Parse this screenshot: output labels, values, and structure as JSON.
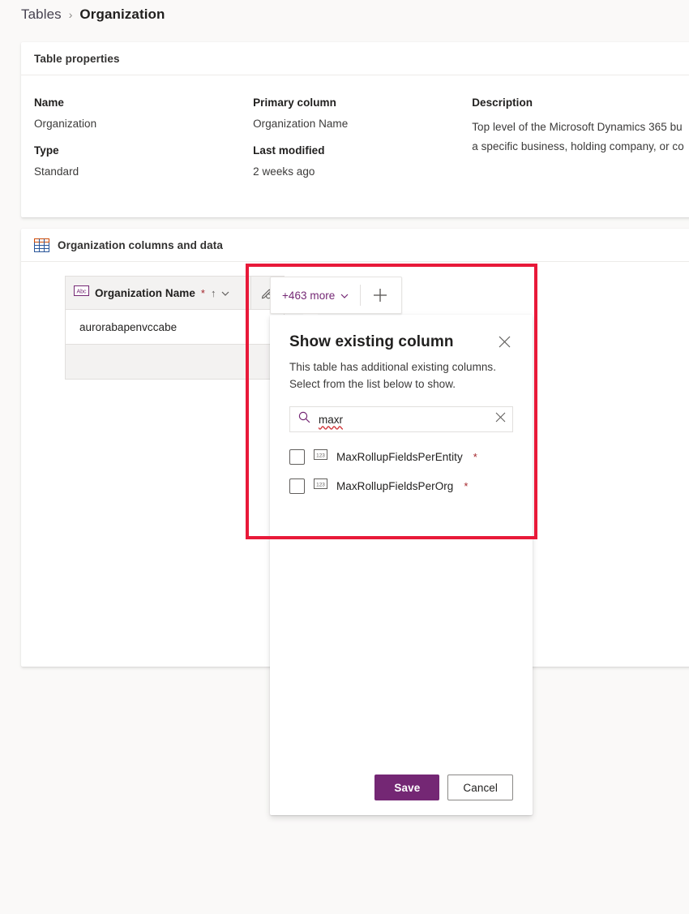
{
  "breadcrumb": {
    "root": "Tables",
    "separator": "›",
    "current": "Organization"
  },
  "properties_card": {
    "title": "Table properties",
    "fields": [
      {
        "label": "Name",
        "value": "Organization"
      },
      {
        "label": "Type",
        "value": "Standard"
      },
      {
        "label": "Primary column",
        "value": "Organization Name"
      },
      {
        "label": "Last modified",
        "value": "2 weeks ago"
      },
      {
        "label": "Description",
        "value": ""
      }
    ],
    "description_lines": [
      "Top level of the Microsoft Dynamics 365 bu",
      "a specific business, holding company, or co"
    ]
  },
  "grid_card": {
    "title": "Organization columns and data",
    "icon": "table-grid-icon",
    "column_header": {
      "icon": "abc-text-column-icon",
      "label": "Organization Name",
      "required_marker": "*",
      "sort_indicator": "↑"
    },
    "rows": [
      {
        "value": "aurorabapenvccabe"
      },
      {
        "value": ""
      }
    ],
    "more_columns_button": {
      "label": "+463 more",
      "chevron": "chevron-down-icon",
      "add_label": "+"
    }
  },
  "panel": {
    "title": "Show existing column",
    "close_label": "✕",
    "subtitle_lines": [
      "This table has additional existing columns.",
      "Select from the list below to show."
    ],
    "search": {
      "value": "maxr",
      "placeholder": "Search",
      "icon": "search-icon",
      "clear_icon": "clear-icon"
    },
    "options": [
      {
        "label": "MaxRollupFieldsPerEntity",
        "required_marker": "*",
        "type_icon": "number-column-icon",
        "checked": false
      },
      {
        "label": "MaxRollupFieldsPerOrg",
        "required_marker": "*",
        "type_icon": "number-column-icon",
        "checked": false
      }
    ],
    "footer": {
      "save_label": "Save",
      "cancel_label": "Cancel"
    }
  },
  "colors": {
    "accent_purple": "#742774",
    "annotation_red": "#e81939",
    "required_red": "#a4262c",
    "page_background": "#faf9f8"
  }
}
